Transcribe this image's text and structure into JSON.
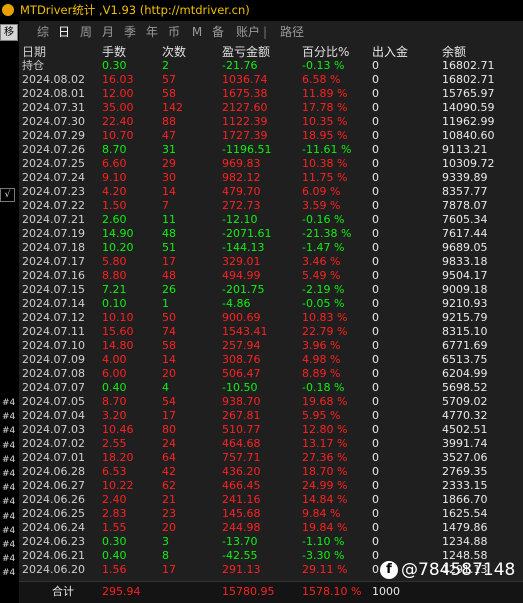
{
  "window": {
    "title": "MTDriver统计 ,V1.93 (http://mtdriver.cn)"
  },
  "left_tab": "移",
  "side_marks": [
    "√",
    "#4",
    "#4",
    "#4",
    "#4",
    "#4",
    "#4",
    "#4",
    "#4",
    "#4",
    "#4",
    "#4",
    "#4",
    "#4"
  ],
  "tabs": [
    {
      "label": "综"
    },
    {
      "label": "日"
    },
    {
      "label": "周"
    },
    {
      "label": "月"
    },
    {
      "label": "季"
    },
    {
      "label": "年"
    },
    {
      "label": "币"
    },
    {
      "label": "M"
    },
    {
      "label": "备"
    },
    {
      "label": "账户"
    },
    {
      "label": "|"
    },
    {
      "label": "路径"
    }
  ],
  "active_tab": "日",
  "columns": [
    "日期",
    "手数",
    "次数",
    "盈亏金额",
    "百分比%",
    "出入金",
    "余额"
  ],
  "holding": [
    "持仓",
    "0.30",
    "2",
    "-21.76",
    "-0.13 %",
    "0",
    "16802.71"
  ],
  "rows": [
    [
      "2024.08.02",
      "16.03",
      "57",
      "1036.74",
      "6.58 %",
      "0",
      "16802.71"
    ],
    [
      "2024.08.01",
      "12.00",
      "58",
      "1675.38",
      "11.89 %",
      "0",
      "15765.97"
    ],
    [
      "2024.07.31",
      "35.00",
      "142",
      "2127.60",
      "17.78 %",
      "0",
      "14090.59"
    ],
    [
      "2024.07.30",
      "22.40",
      "88",
      "1122.39",
      "10.35 %",
      "0",
      "11962.99"
    ],
    [
      "2024.07.29",
      "10.70",
      "47",
      "1727.39",
      "18.95 %",
      "0",
      "10840.60"
    ],
    [
      "2024.07.26",
      "8.70",
      "31",
      "-1196.51",
      "-11.61 %",
      "0",
      "9113.21"
    ],
    [
      "2024.07.25",
      "6.60",
      "29",
      "969.83",
      "10.38 %",
      "0",
      "10309.72"
    ],
    [
      "2024.07.24",
      "9.10",
      "30",
      "982.12",
      "11.75 %",
      "0",
      "9339.89"
    ],
    [
      "2024.07.23",
      "4.20",
      "14",
      "479.70",
      "6.09 %",
      "0",
      "8357.77"
    ],
    [
      "2024.07.22",
      "1.50",
      "7",
      "272.73",
      "3.59 %",
      "0",
      "7878.07"
    ],
    [
      "2024.07.21",
      "2.60",
      "11",
      "-12.10",
      "-0.16 %",
      "0",
      "7605.34"
    ],
    [
      "2024.07.19",
      "14.90",
      "48",
      "-2071.61",
      "-21.38 %",
      "0",
      "7617.44"
    ],
    [
      "2024.07.18",
      "10.20",
      "51",
      "-144.13",
      "-1.47 %",
      "0",
      "9689.05"
    ],
    [
      "2024.07.17",
      "5.80",
      "17",
      "329.01",
      "3.46 %",
      "0",
      "9833.18"
    ],
    [
      "2024.07.16",
      "8.80",
      "48",
      "494.99",
      "5.49 %",
      "0",
      "9504.17"
    ],
    [
      "2024.07.15",
      "7.21",
      "26",
      "-201.75",
      "-2.19 %",
      "0",
      "9009.18"
    ],
    [
      "2024.07.14",
      "0.10",
      "1",
      "-4.86",
      "-0.05 %",
      "0",
      "9210.93"
    ],
    [
      "2024.07.12",
      "10.10",
      "50",
      "900.69",
      "10.83 %",
      "0",
      "9215.79"
    ],
    [
      "2024.07.11",
      "15.60",
      "74",
      "1543.41",
      "22.79 %",
      "0",
      "8315.10"
    ],
    [
      "2024.07.10",
      "14.80",
      "58",
      "257.94",
      "3.96 %",
      "0",
      "6771.69"
    ],
    [
      "2024.07.09",
      "4.00",
      "14",
      "308.76",
      "4.98 %",
      "0",
      "6513.75"
    ],
    [
      "2024.07.08",
      "6.00",
      "20",
      "506.47",
      "8.89 %",
      "0",
      "6204.99"
    ],
    [
      "2024.07.07",
      "0.40",
      "4",
      "-10.50",
      "-0.18 %",
      "0",
      "5698.52"
    ],
    [
      "2024.07.05",
      "8.70",
      "54",
      "938.70",
      "19.68 %",
      "0",
      "5709.02"
    ],
    [
      "2024.07.04",
      "3.20",
      "17",
      "267.81",
      "5.95 %",
      "0",
      "4770.32"
    ],
    [
      "2024.07.03",
      "10.46",
      "80",
      "510.77",
      "12.80 %",
      "0",
      "4502.51"
    ],
    [
      "2024.07.02",
      "2.55",
      "24",
      "464.68",
      "13.17 %",
      "0",
      "3991.74"
    ],
    [
      "2024.07.01",
      "18.20",
      "64",
      "757.71",
      "27.36 %",
      "0",
      "3527.06"
    ],
    [
      "2024.06.28",
      "6.53",
      "42",
      "436.20",
      "18.70 %",
      "0",
      "2769.35"
    ],
    [
      "2024.06.27",
      "10.22",
      "62",
      "466.45",
      "24.99 %",
      "0",
      "2333.15"
    ],
    [
      "2024.06.26",
      "2.40",
      "21",
      "241.16",
      "14.84 %",
      "0",
      "1866.70"
    ],
    [
      "2024.06.25",
      "2.83",
      "23",
      "145.68",
      "9.84 %",
      "0",
      "1625.54"
    ],
    [
      "2024.06.24",
      "1.55",
      "20",
      "244.98",
      "19.84 %",
      "0",
      "1479.86"
    ],
    [
      "2024.06.23",
      "0.30",
      "3",
      "-13.70",
      "-1.10 %",
      "0",
      "1234.88"
    ],
    [
      "2024.06.21",
      "0.40",
      "8",
      "-42.55",
      "-3.30 %",
      "0",
      "1248.58"
    ],
    [
      "2024.06.20",
      "1.56",
      "17",
      "291.13",
      "29.11 %",
      "0",
      "1291.13"
    ]
  ],
  "totals": {
    "label": "合计",
    "lots": "295.94",
    "profit": "15780.95",
    "percent": "1578.10 %",
    "deposit": "1000"
  },
  "watermark": {
    "icon": "f",
    "text": "@784587148"
  },
  "colors": {
    "profit": "#ff2020",
    "loss": "#10f010",
    "title": "#f0c000",
    "background": "#1f1f1f"
  }
}
